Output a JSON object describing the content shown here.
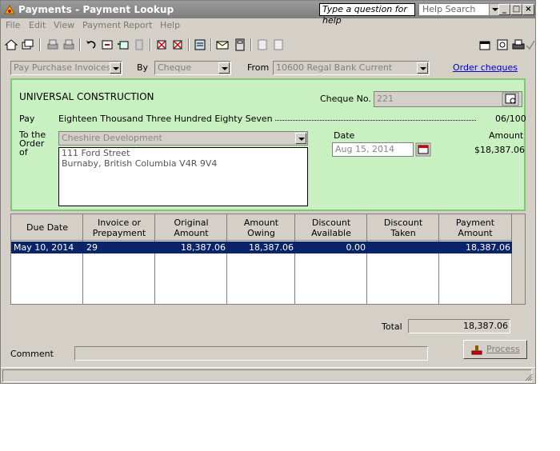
{
  "window": {
    "title": "Payments - Payment Lookup",
    "question_placeholder": "Type a question for help",
    "help_search": "Help Search"
  },
  "menu": [
    "File",
    "Edit",
    "View",
    "Payment",
    "Report",
    "Help"
  ],
  "filter": {
    "type_value": "Pay Purchase Invoices",
    "by_label": "By",
    "by_value": "Cheque",
    "from_label": "From",
    "from_value": "10600 Regal Bank Current",
    "order_link": "Order cheques"
  },
  "cheque": {
    "payee_company": "UNIVERSAL CONSTRUCTION",
    "cheque_no_label": "Cheque No.",
    "cheque_no_value": "221",
    "pay_label": "Pay",
    "pay_words": "Eighteen Thousand Three Hundred Eighty Seven",
    "pay_cents": "06/100",
    "to_order_label": "To the Order of",
    "vendor": "Cheshire Development",
    "address_line1": "111 Ford Street",
    "address_line2": "Burnaby, British Columbia V4R 9V4",
    "date_label": "Date",
    "date_value": "Aug 15, 2014",
    "amount_label": "Amount",
    "amount_value": "$18,387.06"
  },
  "grid": {
    "headers": [
      "Due Date",
      "Invoice or Prepayment",
      "Original Amount",
      "Amount Owing",
      "Discount Available",
      "Discount Taken",
      "Payment Amount"
    ],
    "rows": [
      {
        "due_date": "May 10, 2014",
        "invoice": "29",
        "original": "18,387.06",
        "owing": "18,387.06",
        "disc_avail": "0.00",
        "disc_taken": "",
        "payment": "18,387.06"
      }
    ]
  },
  "footer": {
    "total_label": "Total",
    "total_value": "18,387.06",
    "comment_label": "Comment",
    "comment_value": "",
    "process_label": "Process"
  },
  "colors": {
    "cheque_bg": "#c8f0c0",
    "selection": "#0a246a",
    "link": "#0000cc"
  }
}
